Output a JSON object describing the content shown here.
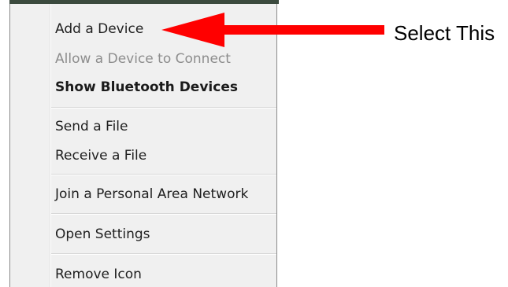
{
  "menu": {
    "items": [
      {
        "label": "Add a Device"
      },
      {
        "label": "Allow a Device to Connect",
        "disabled": true
      },
      {
        "label": "Show Bluetooth Devices",
        "bold": true
      },
      {
        "label": "Send a File"
      },
      {
        "label": "Receive a File"
      },
      {
        "label": "Join a Personal Area Network"
      },
      {
        "label": "Open Settings"
      },
      {
        "label": "Remove Icon"
      }
    ]
  },
  "annotation": {
    "text": "Select This",
    "arrow_color": "#ff0000"
  }
}
